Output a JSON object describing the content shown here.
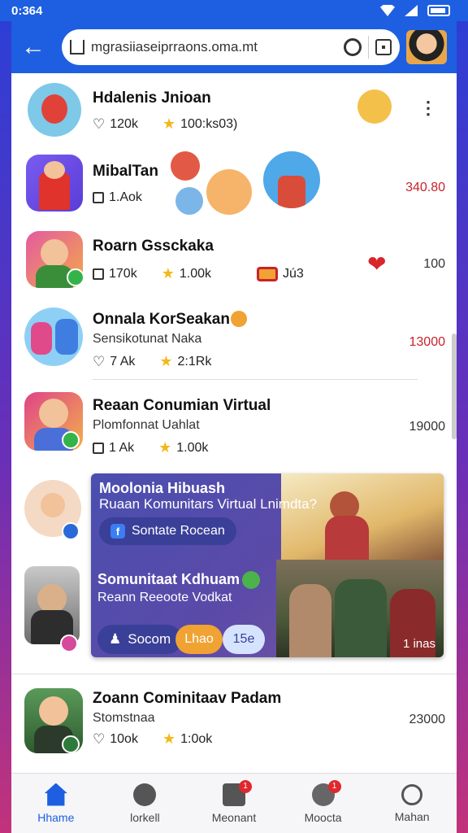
{
  "status": {
    "time": "0:364"
  },
  "browser": {
    "url": "mgrasiiaseiprraons.oma.mt"
  },
  "rows": [
    {
      "title": "Hdalenis Jnioan",
      "stat1": "120k",
      "stat2": "100:ks03)",
      "right": ""
    },
    {
      "title": "MibalTan",
      "stat1": "1.Aok",
      "right": "340.80"
    },
    {
      "title": "Roarn Gssckaka",
      "stat1": "170k",
      "stat2": "1.00k",
      "stat3": "Jú3",
      "right": "100"
    },
    {
      "title": "Onnala KorSeakan",
      "sub": "Sensikotunat Naka",
      "stat1": "7 Ak",
      "stat2": "2:1Rk",
      "right": "13000"
    },
    {
      "title": "Reaan Conumian Virtual",
      "sub": "Plomfonnat Uahlat",
      "stat1": "1 Ak",
      "stat2": "1.00k",
      "right": "19000"
    },
    {
      "title": "Zoann Cominitaav Padam",
      "sub": "Stomstnaa",
      "stat1": "10ok",
      "stat2": "1:0ok",
      "right": "23000"
    }
  ],
  "promo": {
    "title": "Moolonia Hibuash",
    "subtitle": "Ruaan Komunitars Virtual Lnimdta?",
    "button1": "Sontate Rocean",
    "title2": "Somunitaat Kdhuam",
    "subtitle2": "Reann Reeoote Vodkat",
    "button2": "Socom",
    "pill_orange": "Lhao",
    "pill_blue": "15e",
    "corner": "1 inas"
  },
  "nav": [
    {
      "label": "Hhame",
      "icon": "home-icon"
    },
    {
      "label": "lorkell",
      "icon": "compass-icon"
    },
    {
      "label": "Meonant",
      "icon": "message-icon",
      "badge": "1"
    },
    {
      "label": "Moocta",
      "icon": "chat-icon",
      "badge": "1"
    },
    {
      "label": "Mahan",
      "icon": "profile-icon"
    }
  ]
}
